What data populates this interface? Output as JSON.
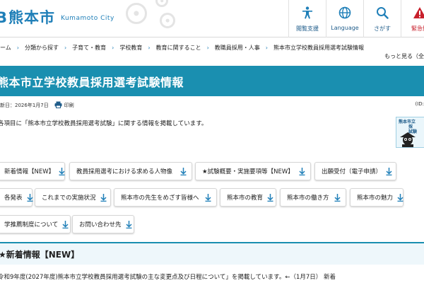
{
  "header": {
    "logo_mark": "B",
    "logo_text": "熊本市",
    "logo_sub": "Kumamoto City",
    "nav": [
      {
        "label": "閲覧支援",
        "icon": "accessibility-icon"
      },
      {
        "label": "Language",
        "icon": "globe-icon"
      },
      {
        "label": "さがす",
        "icon": "search-icon"
      },
      {
        "label": "緊急情",
        "icon": "warning-icon"
      }
    ]
  },
  "breadcrumb": [
    "ーム",
    "分類から探す",
    "子育て・教育",
    "学校教育",
    "教育に関すること",
    "教職員採用・人事",
    "熊本市立学校教員採用選考試験情報"
  ],
  "more_link": "もっと見る（全",
  "page_title": "熊本市立学校教員採用選考試験情報",
  "meta": {
    "updated": "新日：2026年1月7日",
    "print_label": "印刷",
    "right": "(ID:"
  },
  "intro": "各項目に「熊本市立学校教員採用選考試験」に関する情報を掲載しています。",
  "badge_text": [
    "熊本市立",
    "採",
    "試験"
  ],
  "chips": [
    "新着情報【NEW】",
    "教員採用選考における求める人物像",
    "★試験概要・実施要項等【NEW】",
    "出願受付（電子申請）",
    "各発表",
    "これまでの実施状況",
    "熊本市の先生をめざす皆様へ",
    "熊本市の教育",
    "熊本市の働き方",
    "熊本市の魅力",
    "学推薦制度について",
    "お問い合わせ先"
  ],
  "section_title": "★新着情報【NEW】",
  "news_text": "令和9年度(2027年度)熊本市立学校教員採用選考試験の主な変更点及び日程について」を掲載しています。←（1月7日） 新着",
  "colors": {
    "brand_blue": "#1f7fb8",
    "title_bar": "#1a8fb0",
    "alert_red": "#c8202c"
  }
}
